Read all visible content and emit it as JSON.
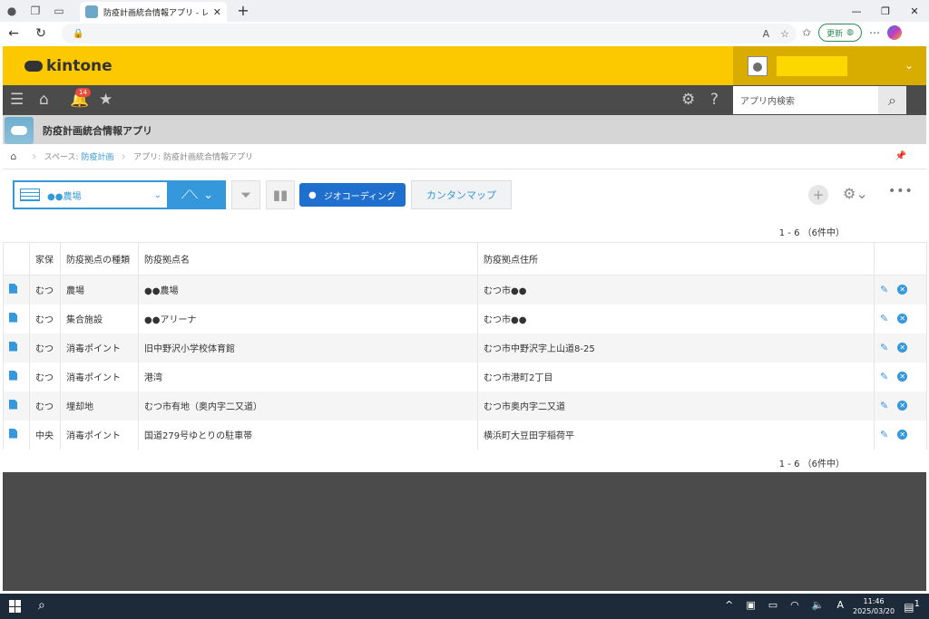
{
  "browser": {
    "tab_title": "防疫計画統合情報アプリ - レコードの",
    "update_label": "更新"
  },
  "header": {
    "logo_text": "kintone"
  },
  "nav": {
    "notification_count": "14",
    "search_placeholder": "アプリ内検索"
  },
  "app": {
    "title": "防疫計画統合情報アプリ"
  },
  "breadcrumb": {
    "space_prefix": "スペース:",
    "space_link": "防疫計画",
    "app_label": "アプリ: 防疫計画統合情報アプリ"
  },
  "toolbar": {
    "view_name": "●●農場",
    "geocoding_label": "ジオコーディング",
    "map_label": "カンタンマップ",
    "pager": "1 - 6 （6件中）"
  },
  "table": {
    "headers": [
      "家保",
      "防疫拠点の種類",
      "防疫拠点名",
      "防疫拠点住所"
    ],
    "rows": [
      [
        "むつ",
        "農場",
        "●●農場",
        "むつ市●●"
      ],
      [
        "むつ",
        "集合施設",
        "●●アリーナ",
        "むつ市●●"
      ],
      [
        "むつ",
        "消毒ポイント",
        "旧中野沢小学校体育館",
        "むつ市中野沢字上山道8-25"
      ],
      [
        "むつ",
        "消毒ポイント",
        "港湾",
        "むつ市港町2丁目"
      ],
      [
        "むつ",
        "埋却地",
        "むつ市有地（奥内字二又道）",
        "むつ市奥内字二又道"
      ],
      [
        "中央",
        "消毒ポイント",
        "国道279号ゆとりの駐車帯",
        "横浜町大豆田字稲荷平"
      ]
    ]
  },
  "taskbar": {
    "ime": "A",
    "time": "11:46",
    "date": "2025/03/20",
    "notif_count": "1"
  },
  "colors": {
    "brand_yellow": "#fcc800",
    "nav_dark": "#4b4b4b",
    "accent_blue": "#3498db"
  }
}
